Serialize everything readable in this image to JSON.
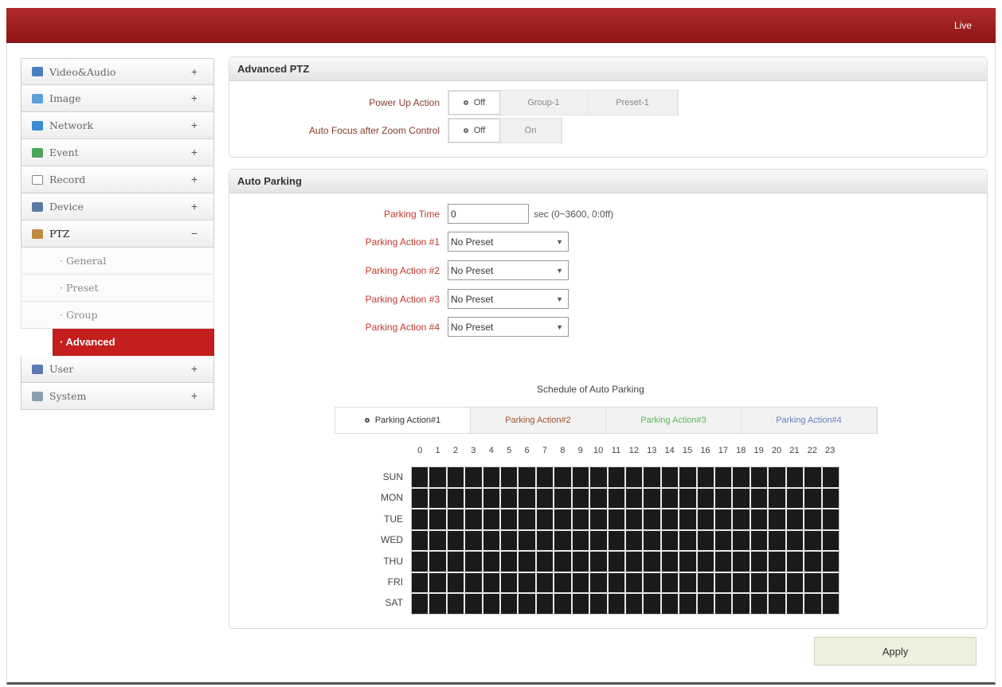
{
  "header": {
    "live_label": "Live"
  },
  "sidebar": {
    "items": [
      {
        "label": "Video&Audio",
        "sign": "+",
        "icon": "video-audio-icon",
        "color": "#4a7fc0"
      },
      {
        "label": "Image",
        "sign": "+",
        "icon": "image-icon",
        "color": "#5aa0d8"
      },
      {
        "label": "Network",
        "sign": "+",
        "icon": "network-icon",
        "color": "#3a8bd0"
      },
      {
        "label": "Event",
        "sign": "+",
        "icon": "event-icon",
        "color": "#4aa45a"
      },
      {
        "label": "Record",
        "sign": "+",
        "icon": "record-icon",
        "color": "#888888"
      },
      {
        "label": "Device",
        "sign": "+",
        "icon": "device-icon",
        "color": "#5a7aa0"
      },
      {
        "label": "PTZ",
        "sign": "−",
        "icon": "ptz-icon",
        "color": "#c08a40"
      }
    ],
    "ptz_sub": [
      {
        "label": "· General"
      },
      {
        "label": "· Preset"
      },
      {
        "label": "· Group"
      },
      {
        "label": "· Advanced",
        "active": true
      }
    ],
    "items_after": [
      {
        "label": "User",
        "sign": "+",
        "icon": "user-icon",
        "color": "#5a7ab0"
      },
      {
        "label": "System",
        "sign": "+",
        "icon": "system-icon",
        "color": "#8aa0b0"
      }
    ]
  },
  "advanced_ptz": {
    "title": "Advanced PTZ",
    "power_up": {
      "label": "Power Up Action",
      "options": [
        "Off",
        "Group-1",
        "Preset-1"
      ],
      "selected": "Off"
    },
    "auto_focus": {
      "label": "Auto Focus after Zoom Control",
      "options": [
        "Off",
        "On"
      ],
      "selected": "Off"
    }
  },
  "auto_parking": {
    "title": "Auto Parking",
    "parking_time": {
      "label": "Parking Time",
      "value": "0",
      "unit": "sec (0~3600, 0:0ff)"
    },
    "actions": [
      {
        "label": "Parking Action #1",
        "value": "No Preset"
      },
      {
        "label": "Parking Action #2",
        "value": "No Preset"
      },
      {
        "label": "Parking Action #3",
        "value": "No Preset"
      },
      {
        "label": "Parking Action #4",
        "value": "No Preset"
      }
    ],
    "schedule_title": "Schedule of Auto Parking",
    "tabs": [
      {
        "label": "Parking Action#1",
        "color": "#333333",
        "selected": true
      },
      {
        "label": "Parking Action#2",
        "color": "#a0522d"
      },
      {
        "label": "Parking Action#3",
        "color": "#5cb85c"
      },
      {
        "label": "Parking Action#4",
        "color": "#6a7fc0"
      }
    ],
    "hours": [
      "0",
      "1",
      "2",
      "3",
      "4",
      "5",
      "6",
      "7",
      "8",
      "9",
      "10",
      "11",
      "12",
      "13",
      "14",
      "15",
      "16",
      "17",
      "18",
      "19",
      "20",
      "21",
      "22",
      "23"
    ],
    "days": [
      "SUN",
      "MON",
      "TUE",
      "WED",
      "THU",
      "FRI",
      "SAT"
    ]
  },
  "apply_label": "Apply"
}
